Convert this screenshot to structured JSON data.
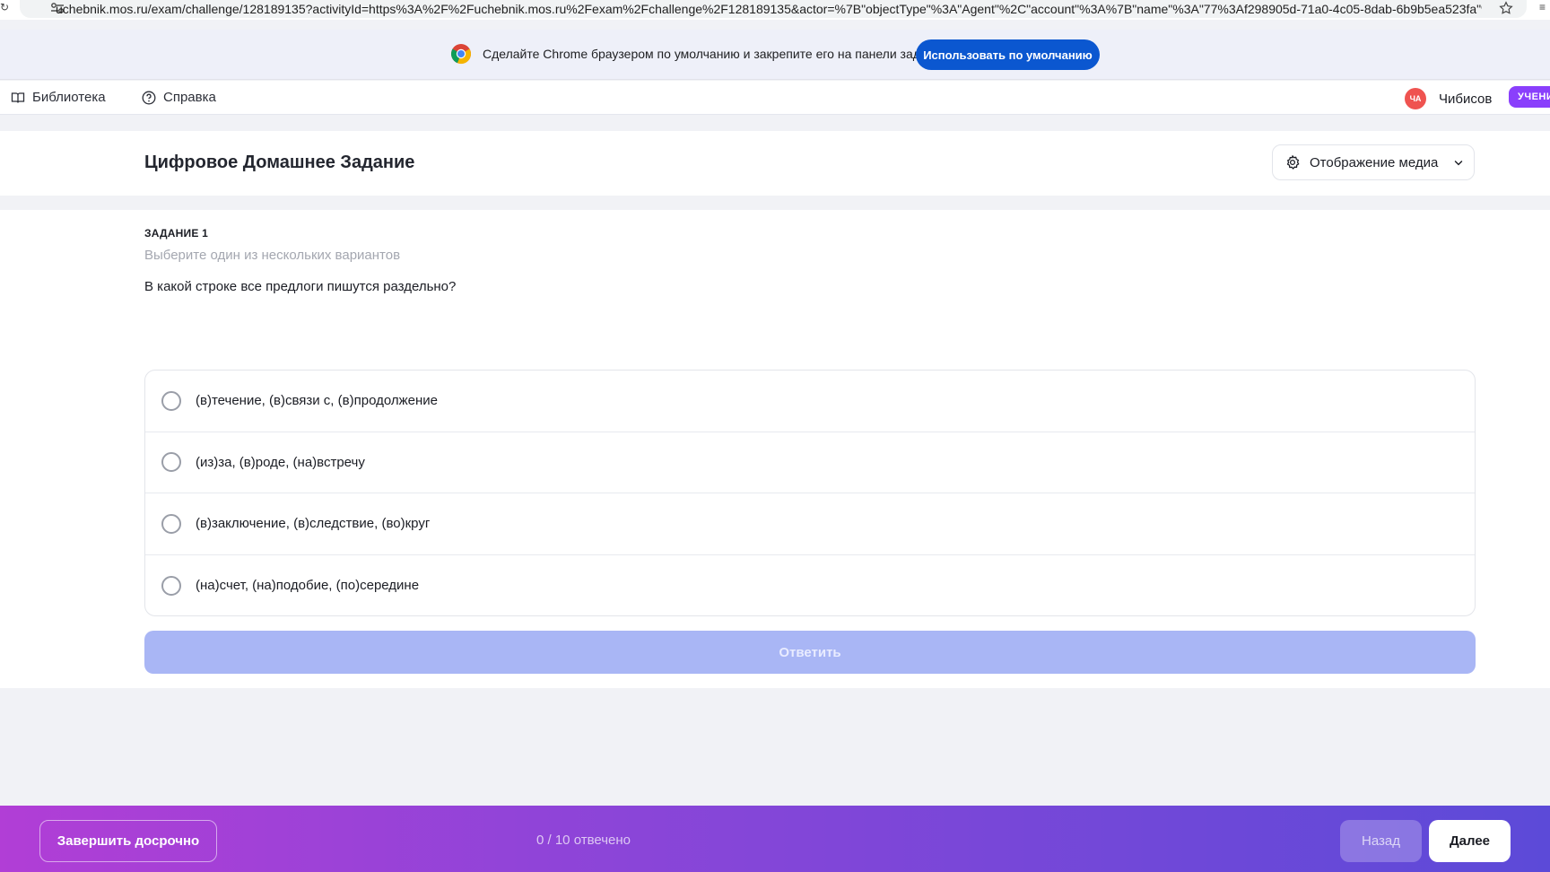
{
  "browser": {
    "url": "uchebnik.mos.ru/exam/challenge/128189135?activityId=https%3A%2F%2Fuchebnik.mos.ru%2Fexam%2Fchallenge%2F128189135&actor=%7B\"objectType\"%3A\"Agent\"%2C\"account\"%3A%7B\"name\"%3A\"77%3Af298905d-71a0-4c05-8dab-6b9b5ea523fa\"%7..."
  },
  "banner": {
    "text": "Сделайте Chrome браузером по умолчанию и закрепите его на панели задач.",
    "button": "Использовать по умолчанию"
  },
  "nav": {
    "library": "Библиотека",
    "help": "Справка",
    "user_initials": "ЧА",
    "user_name": "Чибисов",
    "role": "УЧЕНИ"
  },
  "header": {
    "title": "Цифровое Домашнее Задание",
    "media_button": "Отображение медиа"
  },
  "task": {
    "label": "ЗАДАНИЕ 1",
    "hint": "Выберите один из нескольких вариантов",
    "question": "В какой строке все предлоги пишутся раздельно?",
    "options": [
      "(в)течение, (в)связи с, (в)продолжение",
      "(из)за, (в)роде, (на)встречу",
      "(в)заключение, (в)следствие, (во)круг",
      "(на)счет, (на)подобие, (по)середине"
    ],
    "submit": "Ответить"
  },
  "footer": {
    "finish": "Завершить досрочно",
    "progress": "0 / 10 отвечено",
    "back": "Назад",
    "next": "Далее"
  },
  "colors": {
    "accent": "#8a3ffc",
    "submit_disabled": "#a9b6f5",
    "chrome_button": "#0b57d0",
    "avatar": "#ef5350"
  }
}
